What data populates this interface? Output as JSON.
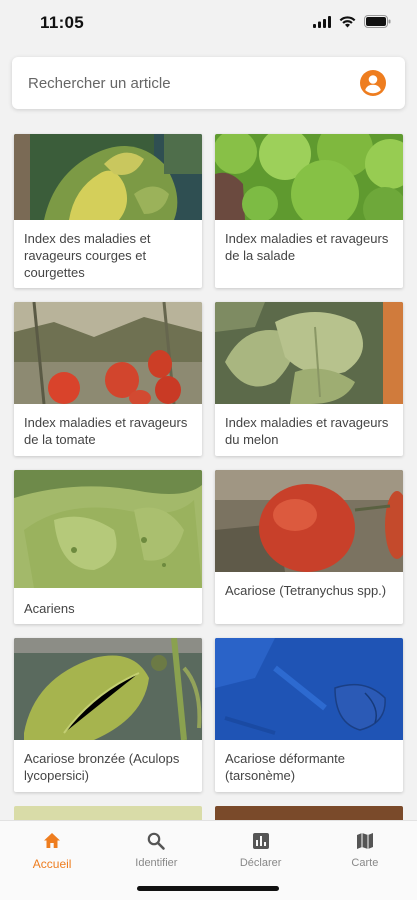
{
  "status_bar": {
    "time": "11:05"
  },
  "search": {
    "placeholder": "Rechercher un article"
  },
  "articles": [
    {
      "title": "Index des maladies et ravageurs courges et courgettes"
    },
    {
      "title": "Index maladies et ravageurs de la salade"
    },
    {
      "title": "Index maladies et ravageurs de la tomate"
    },
    {
      "title": "Index maladies et ravageurs du melon"
    },
    {
      "title": "Acariens"
    },
    {
      "title": "Acariose (Tetranychus spp.)"
    },
    {
      "title": "Acariose bronzée (Aculops lycopersici)"
    },
    {
      "title": "Acariose déformante (tarsonème)"
    }
  ],
  "tabs": [
    {
      "label": "Accueil",
      "icon": "home-icon",
      "active": true
    },
    {
      "label": "Identifier",
      "icon": "search-icon",
      "active": false
    },
    {
      "label": "Déclarer",
      "icon": "bar-chart-icon",
      "active": false
    },
    {
      "label": "Carte",
      "icon": "map-icon",
      "active": false
    }
  ],
  "colors": {
    "accent": "#ee7d1f",
    "inactive": "#888888"
  }
}
